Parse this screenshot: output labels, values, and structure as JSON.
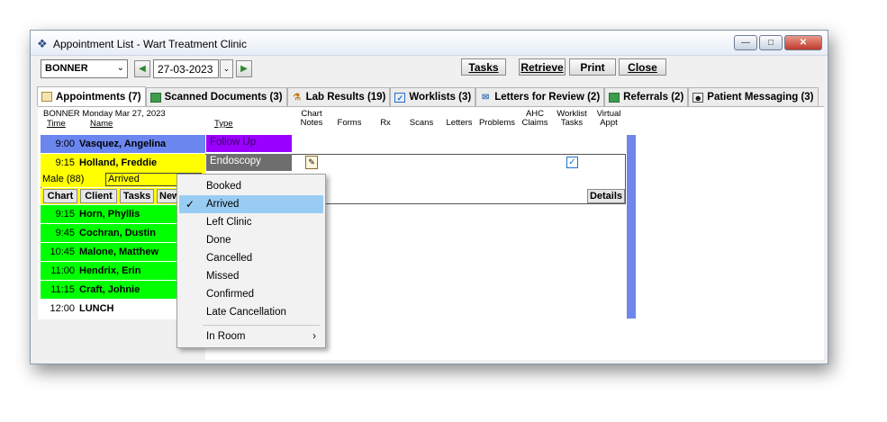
{
  "window": {
    "title": "Appointment List - Wart Treatment Clinic"
  },
  "toolbar": {
    "provider": "BONNER",
    "date": "27-03-2023",
    "tasks": "Tasks",
    "retrieve": "Retrieve",
    "print": "Print",
    "close": "Close"
  },
  "tabs": [
    {
      "label": "Appointments (7)"
    },
    {
      "label": "Scanned Documents (3)"
    },
    {
      "label": "Lab Results (19)"
    },
    {
      "label": "Worklists (3)"
    },
    {
      "label": "Letters for Review (2)"
    },
    {
      "label": "Referrals (2)"
    },
    {
      "label": "Patient Messaging (3)"
    }
  ],
  "list": {
    "header": "BONNER  Monday Mar 27, 2023",
    "col_time": "Time",
    "col_name": "Name",
    "col_type": "Type",
    "columns": [
      {
        "line1": "Chart",
        "line2": "Notes"
      },
      {
        "line1": "",
        "line2": "Forms"
      },
      {
        "line1": "",
        "line2": "Rx"
      },
      {
        "line1": "",
        "line2": "Scans"
      },
      {
        "line1": "",
        "line2": "Letters"
      },
      {
        "line1": "",
        "line2": "Problems"
      },
      {
        "line1": "AHC",
        "line2": "Claims"
      },
      {
        "line1": "Worklist",
        "line2": "Tasks"
      },
      {
        "line1": "Virtual",
        "line2": "Appt"
      }
    ],
    "appointments": [
      {
        "time": "9:00",
        "name": "Vasquez, Angelina",
        "type": "Follow Up"
      },
      {
        "time": "9:15",
        "name": "Holland, Freddie",
        "type": "Endoscopy"
      },
      {
        "time": "9:15",
        "name": "Horn, Phyllis",
        "type": ""
      },
      {
        "time": "9:45",
        "name": "Cochran, Dustin",
        "type": ""
      },
      {
        "time": "10:45",
        "name": "Malone, Matthew",
        "type": ""
      },
      {
        "time": "11:00",
        "name": "Hendrix, Erin",
        "type": ""
      },
      {
        "time": "11:15",
        "name": "Craft, Johnie",
        "type": ""
      },
      {
        "time": "12:00",
        "name": "LUNCH",
        "type": ""
      }
    ],
    "expanded": {
      "patient_info": "Male (88)",
      "status": "Arrived",
      "buttons": {
        "chart": "Chart",
        "client": "Client",
        "tasks": "Tasks",
        "new": "New",
        "details": "Details"
      }
    }
  },
  "status_menu": {
    "items": [
      "Booked",
      "Arrived",
      "Left Clinic",
      "Done",
      "Cancelled",
      "Missed",
      "Confirmed",
      "Late Cancellation"
    ],
    "selected": "Arrived",
    "submenu": "In Room"
  },
  "colors": {
    "blue_row": "#6b86ef",
    "yellow_row": "#ffff00",
    "green_row": "#00ff00",
    "follow_up": "#9a00ff",
    "endoscopy": "#6e6e6e",
    "menu_highlight": "#99ccf2"
  }
}
